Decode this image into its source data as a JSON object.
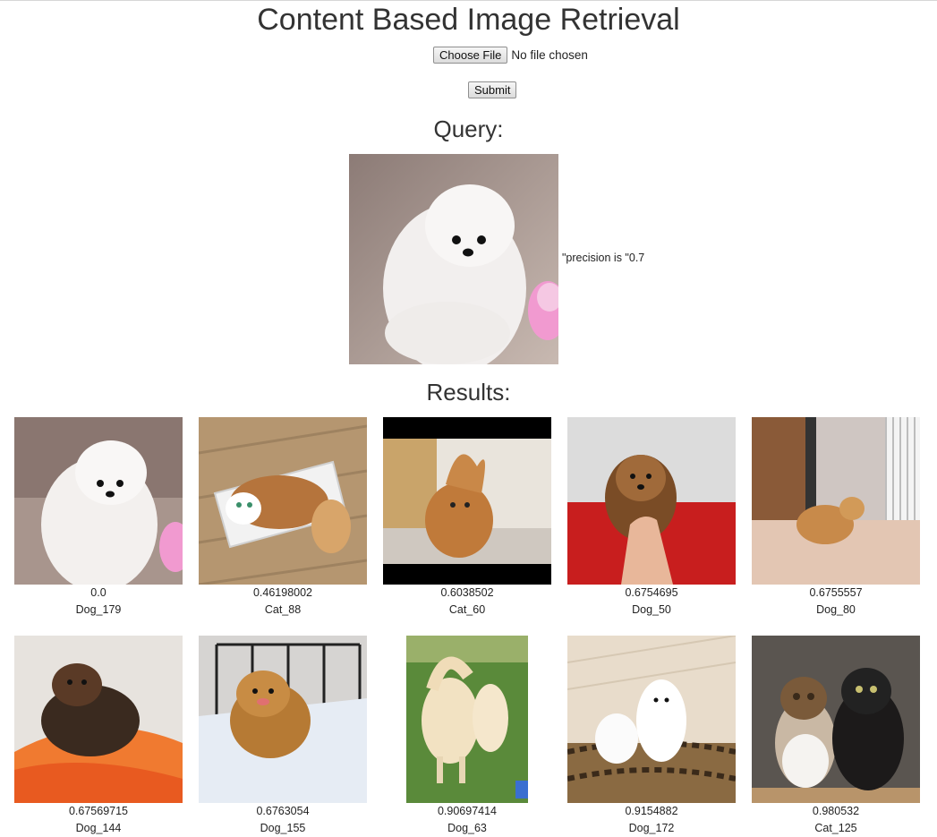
{
  "header": {
    "title": "Content Based Image Retrieval"
  },
  "upload": {
    "choose_label": "Choose File",
    "file_status": "No file chosen",
    "submit_label": "Submit"
  },
  "query": {
    "heading": "Query:",
    "precision_text": "\"precision is \"0.7"
  },
  "results": {
    "heading": "Results:",
    "items": [
      {
        "score": "0.0",
        "label": "Dog_179",
        "thumb": "white-pomeranian"
      },
      {
        "score": "0.46198002",
        "label": "Cat_88",
        "thumb": "cat-in-box"
      },
      {
        "score": "0.6038502",
        "label": "Cat_60",
        "thumb": "fluffy-orange-cat"
      },
      {
        "score": "0.6754695",
        "label": "Dog_50",
        "thumb": "pomeranian-held-in-hand"
      },
      {
        "score": "0.6755557",
        "label": "Dog_80",
        "thumb": "tan-pomeranian-on-floor"
      },
      {
        "score": "0.67569715",
        "label": "Dog_144",
        "thumb": "dark-pomeranian-on-blanket"
      },
      {
        "score": "0.6763054",
        "label": "Dog_155",
        "thumb": "brown-pomeranian-on-bed"
      },
      {
        "score": "0.90697414",
        "label": "Dog_63",
        "thumb": "cream-pomeranians-on-grass"
      },
      {
        "score": "0.9154882",
        "label": "Dog_172",
        "thumb": "white-spitz-pair"
      },
      {
        "score": "0.980532",
        "label": "Cat_125",
        "thumb": "two-kittens"
      }
    ]
  }
}
